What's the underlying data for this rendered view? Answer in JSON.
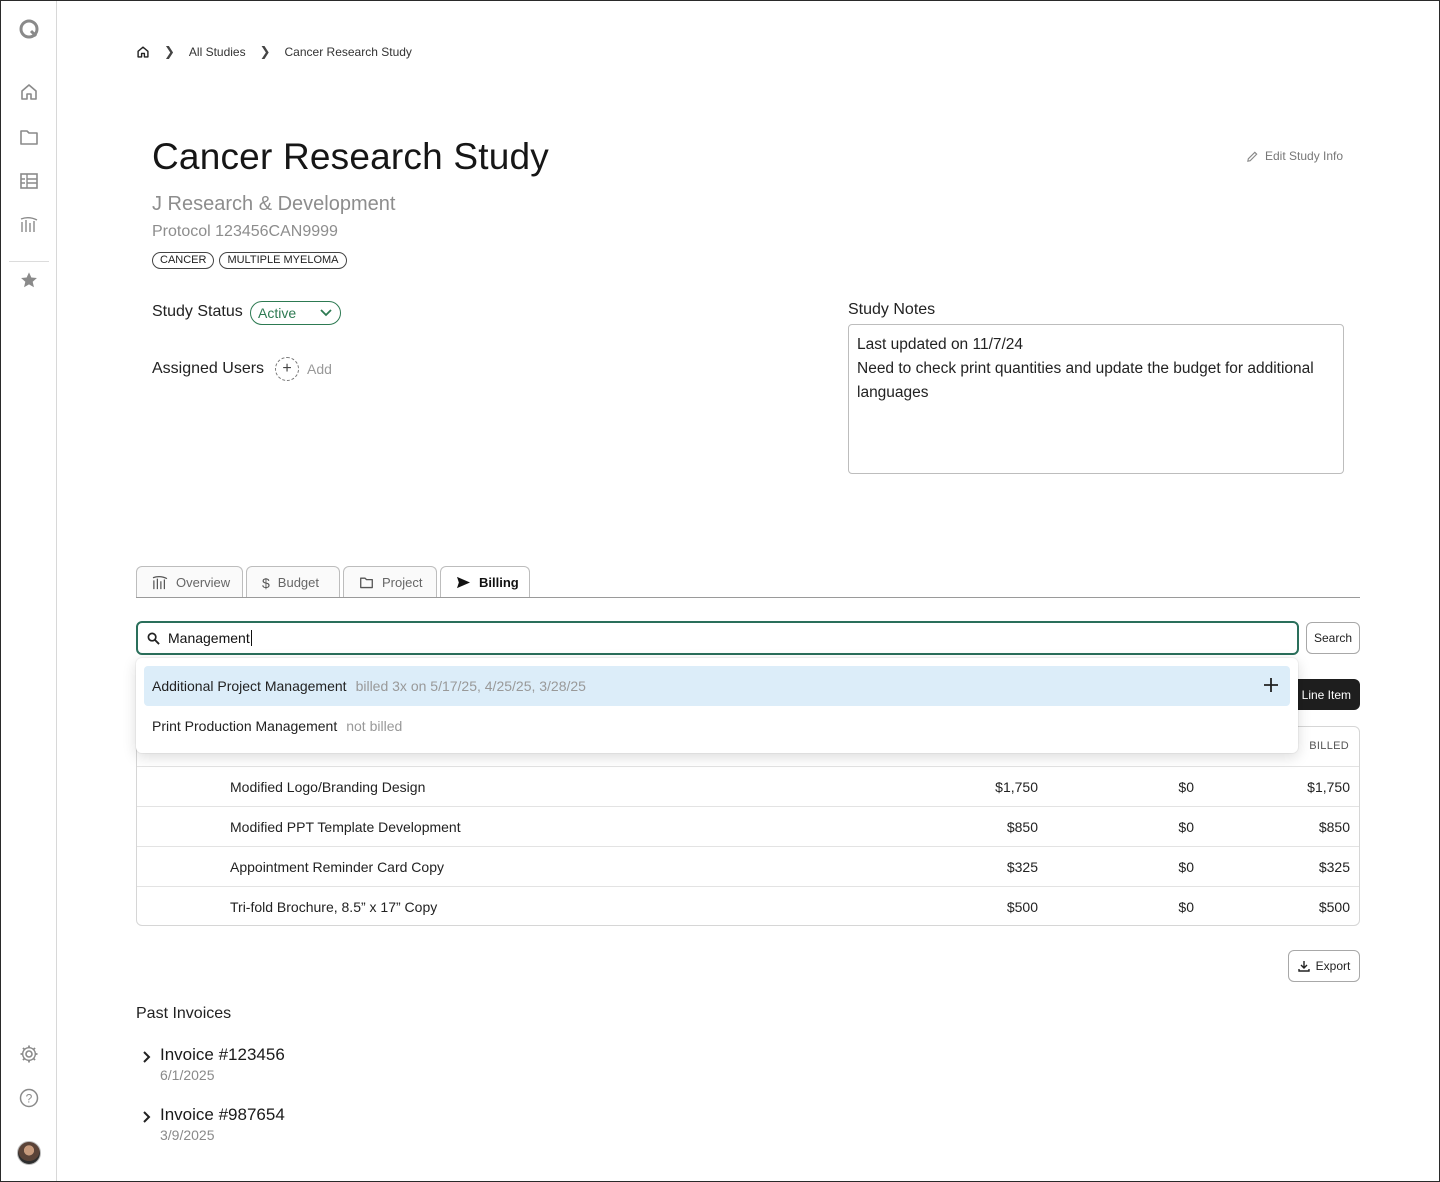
{
  "breadcrumb": {
    "home_icon": "home-icon",
    "items": [
      "All Studies",
      "Cancer Research Study"
    ]
  },
  "study": {
    "title": "Cancer Research Study",
    "edit_label": "Edit Study Info",
    "sponsor": "J Research & Development",
    "protocol": "Protocol 123456CAN9999",
    "tags": [
      "CANCER",
      "MULTIPLE MYELOMA"
    ],
    "status_label": "Study Status",
    "status_value": "Active",
    "users_label": "Assigned Users",
    "add_label": "Add",
    "notes_label": "Study Notes",
    "notes_line1": "Last updated on 11/7/24",
    "notes_line2": "Need to check print quantities and update the budget for additional languages"
  },
  "tabs": [
    {
      "label": "Overview",
      "icon": "chart-icon"
    },
    {
      "label": "Budget",
      "icon": "dollar-icon"
    },
    {
      "label": "Project",
      "icon": "folder-icon"
    },
    {
      "label": "Billing",
      "icon": "send-icon",
      "active": true
    }
  ],
  "search": {
    "value": "Management",
    "button": "Search"
  },
  "dropdown": [
    {
      "name": "Additional Project Management",
      "meta": "billed 3x on 5/17/25, 4/25/25, 3/28/25",
      "highlighted": true
    },
    {
      "name": "Print Production Management",
      "meta": "not billed"
    }
  ],
  "line_item_button": "Line Item",
  "table": {
    "header_billed": "BILLED",
    "rows": [
      {
        "name": "Modified Logo/Branding Design",
        "c1": "$1,750",
        "c2": "$0",
        "c3": "$1,750"
      },
      {
        "name": "Modified PPT Template Development",
        "c1": "$850",
        "c2": "$0",
        "c3": "$850"
      },
      {
        "name": "Appointment Reminder Card Copy",
        "c1": "$325",
        "c2": "$0",
        "c3": "$325"
      },
      {
        "name": "Tri-fold Brochure, 8.5” x 17” Copy",
        "c1": "$500",
        "c2": "$0",
        "c3": "$500"
      }
    ]
  },
  "export_label": "Export",
  "past_invoices": {
    "label": "Past Invoices",
    "items": [
      {
        "number": "Invoice #123456",
        "date": "6/1/2025"
      },
      {
        "number": "Invoice #987654",
        "date": "3/9/2025"
      }
    ]
  },
  "sidebar_icons": [
    "logo-icon",
    "home-icon",
    "folder-icon",
    "table-icon",
    "chart-icon",
    "star-icon",
    "settings-icon",
    "help-icon"
  ],
  "colors": {
    "accent_green": "#2d7a52",
    "search_border": "#2a6f5b",
    "highlight": "#dcedf9"
  }
}
